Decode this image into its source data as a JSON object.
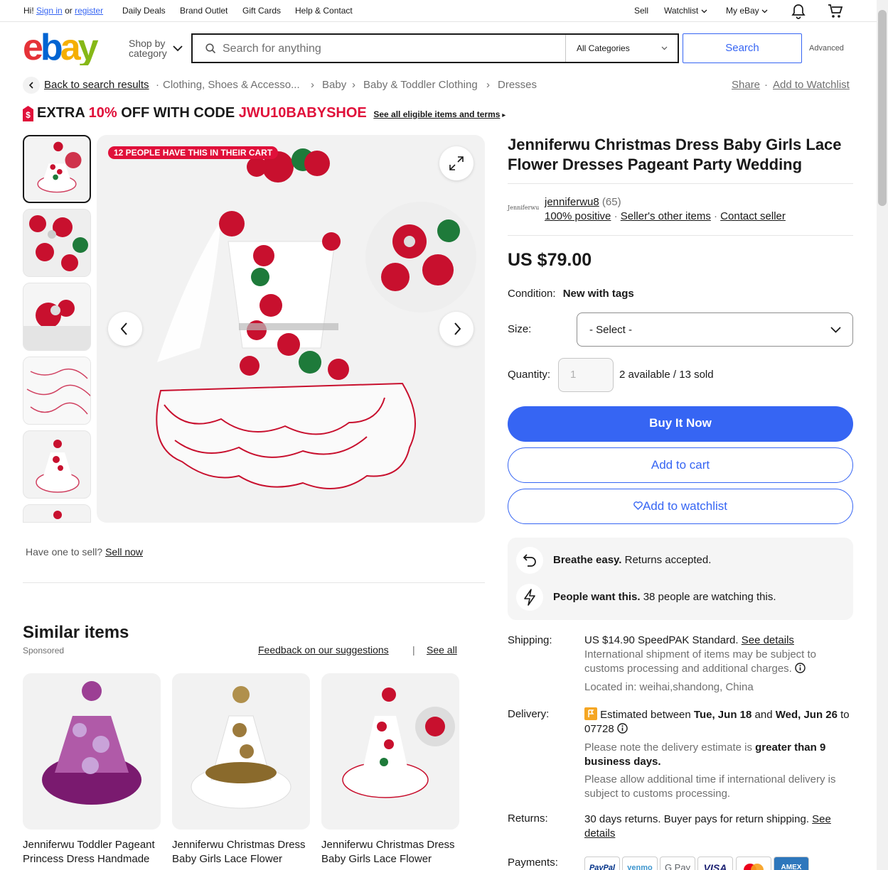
{
  "topbar": {
    "hi": "Hi!",
    "sign_in": "Sign in",
    "or": "or",
    "register": "register",
    "daily_deals": "Daily Deals",
    "brand_outlet": "Brand Outlet",
    "gift_cards": "Gift Cards",
    "help": "Help & Contact",
    "sell": "Sell",
    "watchlist": "Watchlist",
    "my_ebay": "My eBay"
  },
  "header": {
    "shop_by_1": "Shop by",
    "shop_by_2": "category",
    "search_placeholder": "Search for anything",
    "category": "All Categories",
    "search_button": "Search",
    "advanced": "Advanced"
  },
  "breadcrumb": {
    "back": "Back to search results",
    "items": [
      "Clothing, Shoes & Accesso...",
      "Baby",
      "Baby & Toddler Clothing",
      "Dresses"
    ],
    "share": "Share",
    "add_watchlist": "Add to Watchlist"
  },
  "promo": {
    "prefix": "EXTRA ",
    "percent": "10%",
    "mid": " OFF WITH CODE ",
    "code": "JWU10BABYSHOE",
    "link": "See all eligible items and terms"
  },
  "gallery": {
    "badge": "12 PEOPLE HAVE THIS IN THEIR CART"
  },
  "sell": {
    "question": "Have one to sell?",
    "link": "Sell now"
  },
  "listing": {
    "title": "Jenniferwu Christmas Dress Baby Girls Lace Flower Dresses Pageant Party Wedding",
    "seller_logo": "Jenniferwu",
    "seller_name": "jenniferwu8",
    "seller_count": "(65)",
    "positive": "100% positive",
    "other_items": "Seller's other items",
    "contact": "Contact seller",
    "price": "US $79.00",
    "condition_label": "Condition:",
    "condition_value": "New with tags",
    "size_label": "Size:",
    "size_value": "- Select -",
    "quantity_label": "Quantity:",
    "quantity_value": "1",
    "availability": "2 available / 13 sold",
    "buy_now": "Buy It Now",
    "add_cart": "Add to cart",
    "add_watch": "Add to watchlist"
  },
  "info": {
    "breathe_bold": "Breathe easy.",
    "breathe_rest": " Returns accepted.",
    "people_bold": "People want this.",
    "people_rest": " 38 people are watching this."
  },
  "shipping": {
    "label": "Shipping:",
    "line1": "US $14.90 SpeedPAK Standard.",
    "see_details": "See details",
    "note": "International shipment of items may be subject to customs processing and additional charges.",
    "located": "Located in: weihai,shandong, China"
  },
  "delivery": {
    "label": "Delivery:",
    "est_pre": "Estimated between ",
    "date1": "Tue, Jun 18",
    "and": " and ",
    "date2": "Wed, Jun 26",
    "to": " to",
    "zip": "07728",
    "note_pre": "Please note the delivery estimate is ",
    "note_bold": "greater than 9 business days.",
    "note2": "Please allow additional time if international delivery is subject to customs processing."
  },
  "returns": {
    "label": "Returns:",
    "text": "30 days returns. Buyer pays for return shipping.",
    "see": "See",
    "details": "details"
  },
  "payments": {
    "label": "Payments:",
    "methods": [
      "PayPal",
      "venmo",
      "G Pay",
      "VISA",
      "",
      "AMEX"
    ]
  },
  "similar": {
    "title": "Similar items",
    "sponsored": "Sponsored",
    "feedback": "Feedback on our suggestions",
    "sep": "|",
    "see_all": "See all",
    "items": [
      {
        "title": "Jenniferwu Toddler Pageant Princess Dress Handmade"
      },
      {
        "title": "Jenniferwu Christmas Dress Baby Girls Lace Flower"
      },
      {
        "title": "Jenniferwu Christmas Dress Baby Girls Lace Flower"
      }
    ]
  },
  "colors": {
    "accent_blue": "#3665f3",
    "promo_red": "#e0103a",
    "badge_red": "#e0103a"
  }
}
